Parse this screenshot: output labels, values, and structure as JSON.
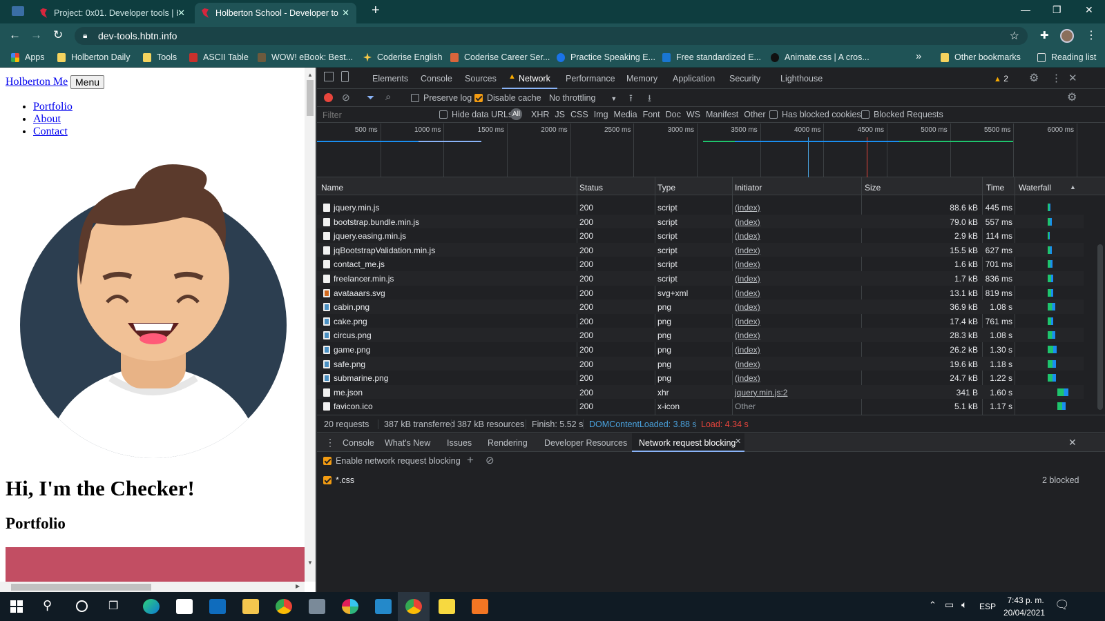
{
  "browser": {
    "tabs": [
      {
        "title": "Project: 0x01. Developer tools | H",
        "active": false
      },
      {
        "title": "Holberton School - Developer to",
        "active": true
      }
    ],
    "new_tab_symbol": "+",
    "url": "dev-tools.hbtn.info",
    "bookmarks": [
      "Apps",
      "Holberton Daily",
      "Tools",
      "ASCII Table",
      "WOW! eBook: Best...",
      "Coderise English",
      "Coderise Career Ser...",
      "Practice Speaking E...",
      "Free standardized E...",
      "Animate.css | A cros..."
    ],
    "bookmarks_overflow": "»",
    "other_bookmarks": "Other bookmarks",
    "reading_list": "Reading list"
  },
  "page": {
    "brand": "Holberton Me",
    "menu_button": "Menu",
    "nav": [
      "Portfolio",
      "About",
      "Contact"
    ],
    "heading": "Hi, I'm the Checker!",
    "subheading": "Portfolio"
  },
  "devtools": {
    "tabs": [
      "Elements",
      "Console",
      "Sources",
      "Network",
      "Performance",
      "Memory",
      "Application",
      "Security",
      "Lighthouse"
    ],
    "active_tab": "Network",
    "warnings": "2",
    "toolbar": {
      "preserve_log": "Preserve log",
      "disable_cache": "Disable cache",
      "throttling": "No throttling"
    },
    "filter": {
      "placeholder": "Filter",
      "hide_data_urls": "Hide data URLs",
      "all": "All",
      "types": [
        "XHR",
        "JS",
        "CSS",
        "Img",
        "Media",
        "Font",
        "Doc",
        "WS",
        "Manifest",
        "Other"
      ],
      "has_blocked_cookies": "Has blocked cookies",
      "blocked_requests": "Blocked Requests"
    },
    "timeline_ticks": [
      "500 ms",
      "1000 ms",
      "1500 ms",
      "2000 ms",
      "2500 ms",
      "3000 ms",
      "3500 ms",
      "4000 ms",
      "4500 ms",
      "5000 ms",
      "5500 ms",
      "6000 ms"
    ],
    "columns": [
      "Name",
      "Status",
      "Type",
      "Initiator",
      "Size",
      "Time",
      "Waterfall"
    ],
    "requests": [
      {
        "name": "jquery.min.js",
        "status": "200",
        "type": "script",
        "initiator": "(index)",
        "size": "88.6 kB",
        "time": "445 ms",
        "icon": "script"
      },
      {
        "name": "bootstrap.bundle.min.js",
        "status": "200",
        "type": "script",
        "initiator": "(index)",
        "size": "79.0 kB",
        "time": "557 ms",
        "icon": "script"
      },
      {
        "name": "jquery.easing.min.js",
        "status": "200",
        "type": "script",
        "initiator": "(index)",
        "size": "2.9 kB",
        "time": "114 ms",
        "icon": "script"
      },
      {
        "name": "jqBootstrapValidation.min.js",
        "status": "200",
        "type": "script",
        "initiator": "(index)",
        "size": "15.5 kB",
        "time": "627 ms",
        "icon": "script"
      },
      {
        "name": "contact_me.js",
        "status": "200",
        "type": "script",
        "initiator": "(index)",
        "size": "1.6 kB",
        "time": "701 ms",
        "icon": "script"
      },
      {
        "name": "freelancer.min.js",
        "status": "200",
        "type": "script",
        "initiator": "(index)",
        "size": "1.7 kB",
        "time": "836 ms",
        "icon": "script"
      },
      {
        "name": "avataaars.svg",
        "status": "200",
        "type": "svg+xml",
        "initiator": "(index)",
        "size": "13.1 kB",
        "time": "819 ms",
        "icon": "svg"
      },
      {
        "name": "cabin.png",
        "status": "200",
        "type": "png",
        "initiator": "(index)",
        "size": "36.9 kB",
        "time": "1.08 s",
        "icon": "png"
      },
      {
        "name": "cake.png",
        "status": "200",
        "type": "png",
        "initiator": "(index)",
        "size": "17.4 kB",
        "time": "761 ms",
        "icon": "png"
      },
      {
        "name": "circus.png",
        "status": "200",
        "type": "png",
        "initiator": "(index)",
        "size": "28.3 kB",
        "time": "1.08 s",
        "icon": "png"
      },
      {
        "name": "game.png",
        "status": "200",
        "type": "png",
        "initiator": "(index)",
        "size": "26.2 kB",
        "time": "1.30 s",
        "icon": "png"
      },
      {
        "name": "safe.png",
        "status": "200",
        "type": "png",
        "initiator": "(index)",
        "size": "19.6 kB",
        "time": "1.18 s",
        "icon": "png"
      },
      {
        "name": "submarine.png",
        "status": "200",
        "type": "png",
        "initiator": "(index)",
        "size": "24.7 kB",
        "time": "1.22 s",
        "icon": "png"
      },
      {
        "name": "me.json",
        "status": "200",
        "type": "xhr",
        "initiator": "jquery.min.js:2",
        "size": "341 B",
        "time": "1.60 s",
        "icon": "script"
      },
      {
        "name": "favicon.ico",
        "status": "200",
        "type": "x-icon",
        "initiator": "Other",
        "size": "5.1 kB",
        "time": "1.17 s",
        "icon": "script"
      }
    ],
    "summary": {
      "requests": "20 requests",
      "transferred": "387 kB transferred",
      "resources": "387 kB resources",
      "finish": "Finish: 5.52 s",
      "dom_loaded": "DOMContentLoaded: 3.88 s",
      "load": "Load: 4.34 s"
    },
    "drawer_tabs": [
      "Console",
      "What's New",
      "Issues",
      "Rendering",
      "Developer Resources",
      "Network request blocking"
    ],
    "drawer_active": "Network request blocking",
    "blocking": {
      "enable_label": "Enable network request blocking",
      "pattern": "*.css",
      "blocked_count": "2 blocked"
    }
  },
  "taskbar": {
    "language": "ESP",
    "time": "7:43 p. m.",
    "date": "20/04/2021"
  },
  "colors": {
    "titlebar": "#0e3d3f",
    "toolbar": "#1f5356",
    "devtools_bg": "#202124",
    "accent_orange": "#f39c12",
    "dom_loaded_blue": "#4aa3df",
    "load_red": "#e8453c",
    "page_banner": "#c24e63"
  }
}
